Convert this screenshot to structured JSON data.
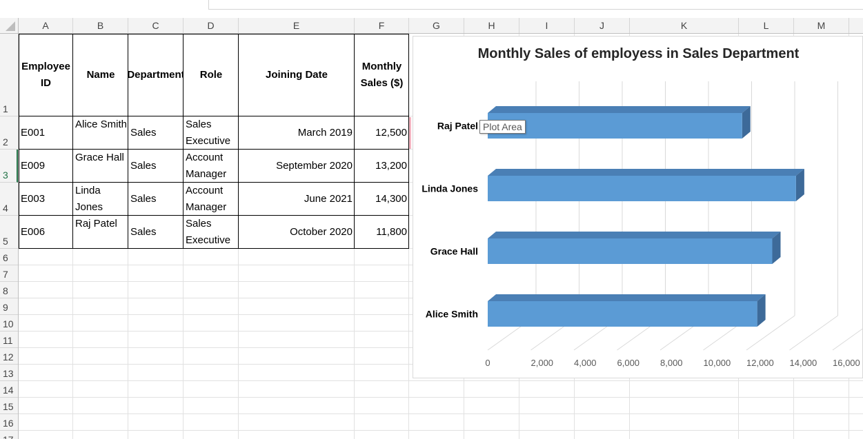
{
  "spreadsheet": {
    "columns": [
      "A",
      "B",
      "C",
      "D",
      "E",
      "F",
      "G",
      "H",
      "I",
      "J",
      "K",
      "L",
      "M"
    ],
    "rows": [
      "1",
      "2",
      "3",
      "4",
      "5",
      "6",
      "7",
      "8",
      "9",
      "10",
      "11",
      "12",
      "13",
      "14",
      "15",
      "16",
      "17"
    ],
    "selected_row": "3"
  },
  "table": {
    "headers": {
      "employee_id": "Employee ID",
      "name": "Name",
      "department": "Department",
      "role": "Role",
      "joining_date": "Joining Date",
      "monthly_sales": "Monthly Sales ($)"
    },
    "rows": [
      {
        "employee_id": "E001",
        "name": "Alice Smith",
        "department": "Sales",
        "role": "Sales Executive",
        "joining_date": "March 2019",
        "monthly_sales": "12,500"
      },
      {
        "employee_id": "E009",
        "name": "Grace Hall",
        "department": "Sales",
        "role": "Account Manager",
        "joining_date": "September 2020",
        "monthly_sales": "13,200"
      },
      {
        "employee_id": "E003",
        "name": "Linda Jones",
        "department": "Sales",
        "role": "Account Manager",
        "joining_date": "June 2021",
        "monthly_sales": "14,300"
      },
      {
        "employee_id": "E006",
        "name": "Raj Patel",
        "department": "Sales",
        "role": "Sales Executive",
        "joining_date": "October 2020",
        "monthly_sales": "11,800"
      }
    ]
  },
  "tooltip": {
    "label": "Plot Area"
  },
  "chart_data": {
    "type": "bar",
    "orientation": "horizontal",
    "style": "3d",
    "title": "Monthly Sales of employess in Sales Department",
    "categories": [
      "Alice Smith",
      "Grace Hall",
      "Linda Jones",
      "Raj Patel"
    ],
    "values": [
      12500,
      13200,
      14300,
      11800
    ],
    "xlim": [
      0,
      16000
    ],
    "x_ticks": [
      0,
      2000,
      4000,
      6000,
      8000,
      10000,
      12000,
      14000,
      16000
    ],
    "x_tick_labels": [
      "0",
      "2,000",
      "4,000",
      "6,000",
      "8,000",
      "10,000",
      "12,000",
      "14,000",
      "16,000"
    ],
    "xlabel": "",
    "ylabel": "",
    "grid": true,
    "legend": "none",
    "colors": {
      "bar_front": "#5b9bd5",
      "bar_top": "#4a7fb5",
      "bar_side": "#3d6a99",
      "grid": "#d9d9d9"
    }
  }
}
